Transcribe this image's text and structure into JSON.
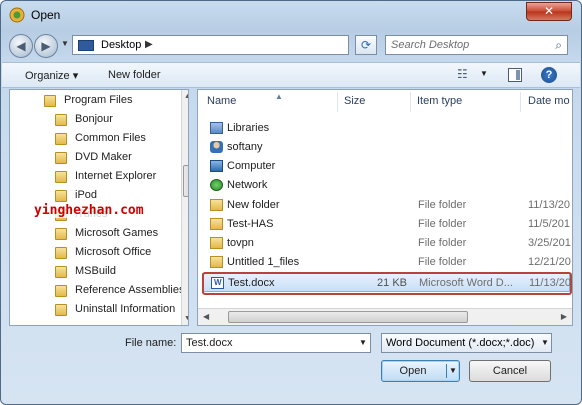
{
  "window": {
    "title": "Open",
    "close_glyph": "✕"
  },
  "address_bar": {
    "location": "Desktop",
    "search_placeholder": "Search Desktop"
  },
  "toolbar": {
    "organize_label": "Organize ▾",
    "new_folder_label": "New folder"
  },
  "tree": {
    "items": [
      {
        "label": "Program Files",
        "indent": 0
      },
      {
        "label": "Bonjour",
        "indent": 1
      },
      {
        "label": "Common Files",
        "indent": 1
      },
      {
        "label": "DVD Maker",
        "indent": 1
      },
      {
        "label": "Internet Explorer",
        "indent": 1
      },
      {
        "label": "iPod",
        "indent": 1
      },
      {
        "label": "iTunes",
        "indent": 1
      },
      {
        "label": "Microsoft Games",
        "indent": 1
      },
      {
        "label": "Microsoft Office",
        "indent": 1
      },
      {
        "label": "MSBuild",
        "indent": 1
      },
      {
        "label": "Reference Assemblies",
        "indent": 1
      },
      {
        "label": "Uninstall Information",
        "indent": 1
      }
    ]
  },
  "columns": {
    "name": "Name",
    "size": "Size",
    "type": "Item type",
    "date": "Date mo"
  },
  "files": [
    {
      "name": "Libraries",
      "size": "",
      "type": "",
      "date": "",
      "icon": "library-icon"
    },
    {
      "name": "softany",
      "size": "",
      "type": "",
      "date": "",
      "icon": "user-folder-icon"
    },
    {
      "name": "Computer",
      "size": "",
      "type": "",
      "date": "",
      "icon": "computer-icon"
    },
    {
      "name": "Network",
      "size": "",
      "type": "",
      "date": "",
      "icon": "network-icon"
    },
    {
      "name": "New folder",
      "size": "",
      "type": "File folder",
      "date": "11/13/20",
      "icon": "folder-icon"
    },
    {
      "name": "Test-HAS",
      "size": "",
      "type": "File folder",
      "date": "11/5/201",
      "icon": "folder-icon"
    },
    {
      "name": "tovpn",
      "size": "",
      "type": "File folder",
      "date": "3/25/201",
      "icon": "folder-icon"
    },
    {
      "name": "Untitled 1_files",
      "size": "",
      "type": "File folder",
      "date": "12/21/20",
      "icon": "folder-icon"
    },
    {
      "name": "Test.docx",
      "size": "21 KB",
      "type": "Microsoft Word D...",
      "date": "11/13/20",
      "icon": "word-document-icon"
    }
  ],
  "bottom": {
    "file_name_label": "File name:",
    "file_name_value": "Test.docx",
    "file_type_value": "Word Document (*.docx;*.doc)",
    "open_label": "Open",
    "cancel_label": "Cancel"
  },
  "watermark": {
    "text": "yinghezhan.com",
    "color": "#d10000"
  },
  "colors": {
    "selection_outline": "#b8433a",
    "selection_fill": "#cfe3f8"
  }
}
